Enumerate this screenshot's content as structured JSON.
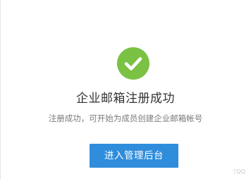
{
  "status": {
    "icon": "check-circle-icon",
    "color": "#7bc144"
  },
  "title": "企业邮箱注册成功",
  "subtitle": "注册成功，可开始为成员创建企业邮箱帐号",
  "actions": {
    "admin_label": "进入管理后台",
    "accent": "#2f8ddc"
  },
  "watermark": "ΞQQ"
}
